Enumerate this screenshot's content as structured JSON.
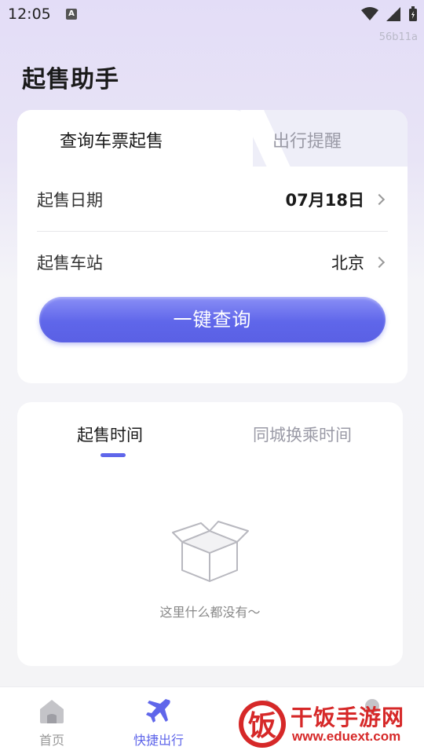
{
  "status_bar": {
    "time": "12:05",
    "badge": "A",
    "build_id": "56b11a"
  },
  "page": {
    "title": "起售助手"
  },
  "query_card": {
    "tabs": [
      {
        "label": "查询车票起售",
        "active": true
      },
      {
        "label": "出行提醒",
        "active": false
      }
    ],
    "date_row": {
      "label": "起售日期",
      "value": "07月18日",
      "icon": "chevron-right-icon"
    },
    "station_row": {
      "label": "起售车站",
      "value": "北京",
      "icon": "chevron-right-icon"
    },
    "query_button": {
      "label": "一键查询"
    }
  },
  "list_card": {
    "tabs": [
      {
        "label": "起售时间",
        "active": true
      },
      {
        "label": "同城换乘时间",
        "active": false
      }
    ],
    "empty_text": "这里什么都没有～",
    "empty_icon": "empty-box-icon"
  },
  "bottom_nav": [
    {
      "label": "首页",
      "icon": "home-icon",
      "active": false
    },
    {
      "label": "快捷出行",
      "icon": "airplane-icon",
      "active": true
    },
    {
      "label": "",
      "icon": "stack-icon",
      "active": false
    },
    {
      "label": "",
      "icon": "person-icon",
      "active": false
    }
  ],
  "overlay_logo": {
    "text": "干饭手游网",
    "url": "www.eduext.com",
    "glyph": "饭"
  },
  "colors": {
    "accent": "#5f66ea",
    "logo_red": "#d62828"
  }
}
